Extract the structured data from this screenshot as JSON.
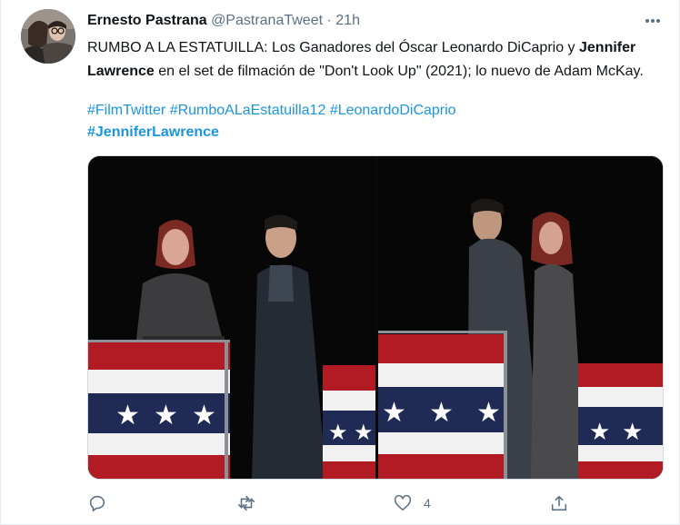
{
  "author": {
    "name": "Ernesto Pastrana",
    "handle": "@PastranaTweet",
    "separator": "·",
    "time": "21h"
  },
  "tweet": {
    "text_part1": "RUMBO A LA ESTATUILLA: Los Ganadores del Óscar Leonardo DiCaprio y ",
    "text_bold": "Jennifer Lawrence",
    "text_part2": " en el set de filmación de \"Don't Look Up\" (2021); lo nuevo de Adam McKay.",
    "hashtags": [
      "#FilmTwitter",
      "#RumboALaEstatuilla12",
      "#LeonardoDiCaprio"
    ],
    "hashtag_bold": "#JenniferLawrence"
  },
  "actions": {
    "reply_icon": "reply-icon",
    "retweet_icon": "retweet-icon",
    "like_icon": "heart-icon",
    "like_count": "4",
    "share_icon": "share-icon"
  },
  "colors": {
    "link": "#1b95e0",
    "muted": "#5b7083",
    "text": "#0f1419"
  }
}
